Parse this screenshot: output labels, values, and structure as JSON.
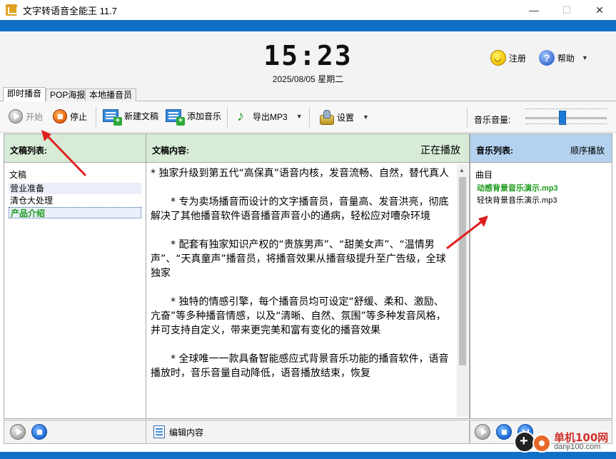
{
  "window": {
    "title": "文字转语音全能王 11.7",
    "minimize": "—",
    "maximize": "☐",
    "close": "✕"
  },
  "header": {
    "time": "15:23",
    "date": "2025/08/05 星期二",
    "register_label": "注册",
    "help_label": "帮助"
  },
  "tabs": [
    {
      "label": "即时播音",
      "active": true
    },
    {
      "label": "POP海报",
      "active": false
    },
    {
      "label": "本地播音员",
      "active": false
    }
  ],
  "toolbar": {
    "start_label": "开始",
    "stop_label": "停止",
    "new_doc_label": "新建文稿",
    "add_music_label": "添加音乐",
    "export_label": "导出MP3",
    "settings_label": "设置",
    "volume_label": "音乐音量:",
    "volume_level": 0.45
  },
  "doc_list": {
    "header": "文稿列表:",
    "column_title": "文稿",
    "items": [
      "营业准备",
      "清仓大处理",
      "产品介绍"
    ],
    "selected_index": 2
  },
  "doc_content": {
    "header": "文稿内容:",
    "status": "正在播放",
    "paragraphs": [
      "* 独家升级到第五代“高保真”语音内核，发音流畅、自然，替代真人",
      "　　* 专为卖场播音而设计的文字播音员，音量高、发音洪亮，彻底解决了其他播音软件语音播音声音小的通病，轻松应对嘈杂环境",
      "　　* 配套有独家知识产权的“贵族男声”、“甜美女声”、“温情男声”、“天真童声”播音员，将播音效果从播音级提升至广告级，全球独家",
      "　　* 独特的情感引擎，每个播音员均可设定“舒缓、柔和、激励、亢奋”等多种播音情感，以及“清晰、自然、氛围”等多种发音风格，并可支持自定义，带来更完美和富有变化的播音效果",
      "　　* 全球唯一一款具备智能感应式背景音乐功能的播音软件，语音播放时，音乐音量自动降低，语音播放结束，恢复"
    ],
    "edit_label": "编辑内容"
  },
  "music_list": {
    "header": "音乐列表:",
    "mode": "顺序播放",
    "column_title": "曲目",
    "items": [
      "动感背景音乐演示.mp3",
      "轻快背景音乐演示.mp3"
    ],
    "playing_index": 0
  },
  "watermark": {
    "site": "单机100网",
    "url": "danji100.com"
  },
  "colors": {
    "accent_blue": "#1070c8",
    "list_header_green": "#d7ebd7",
    "music_header_blue": "#b4d2ef",
    "playing_green": "#1a9a1a",
    "annotation_red": "#e02020"
  }
}
